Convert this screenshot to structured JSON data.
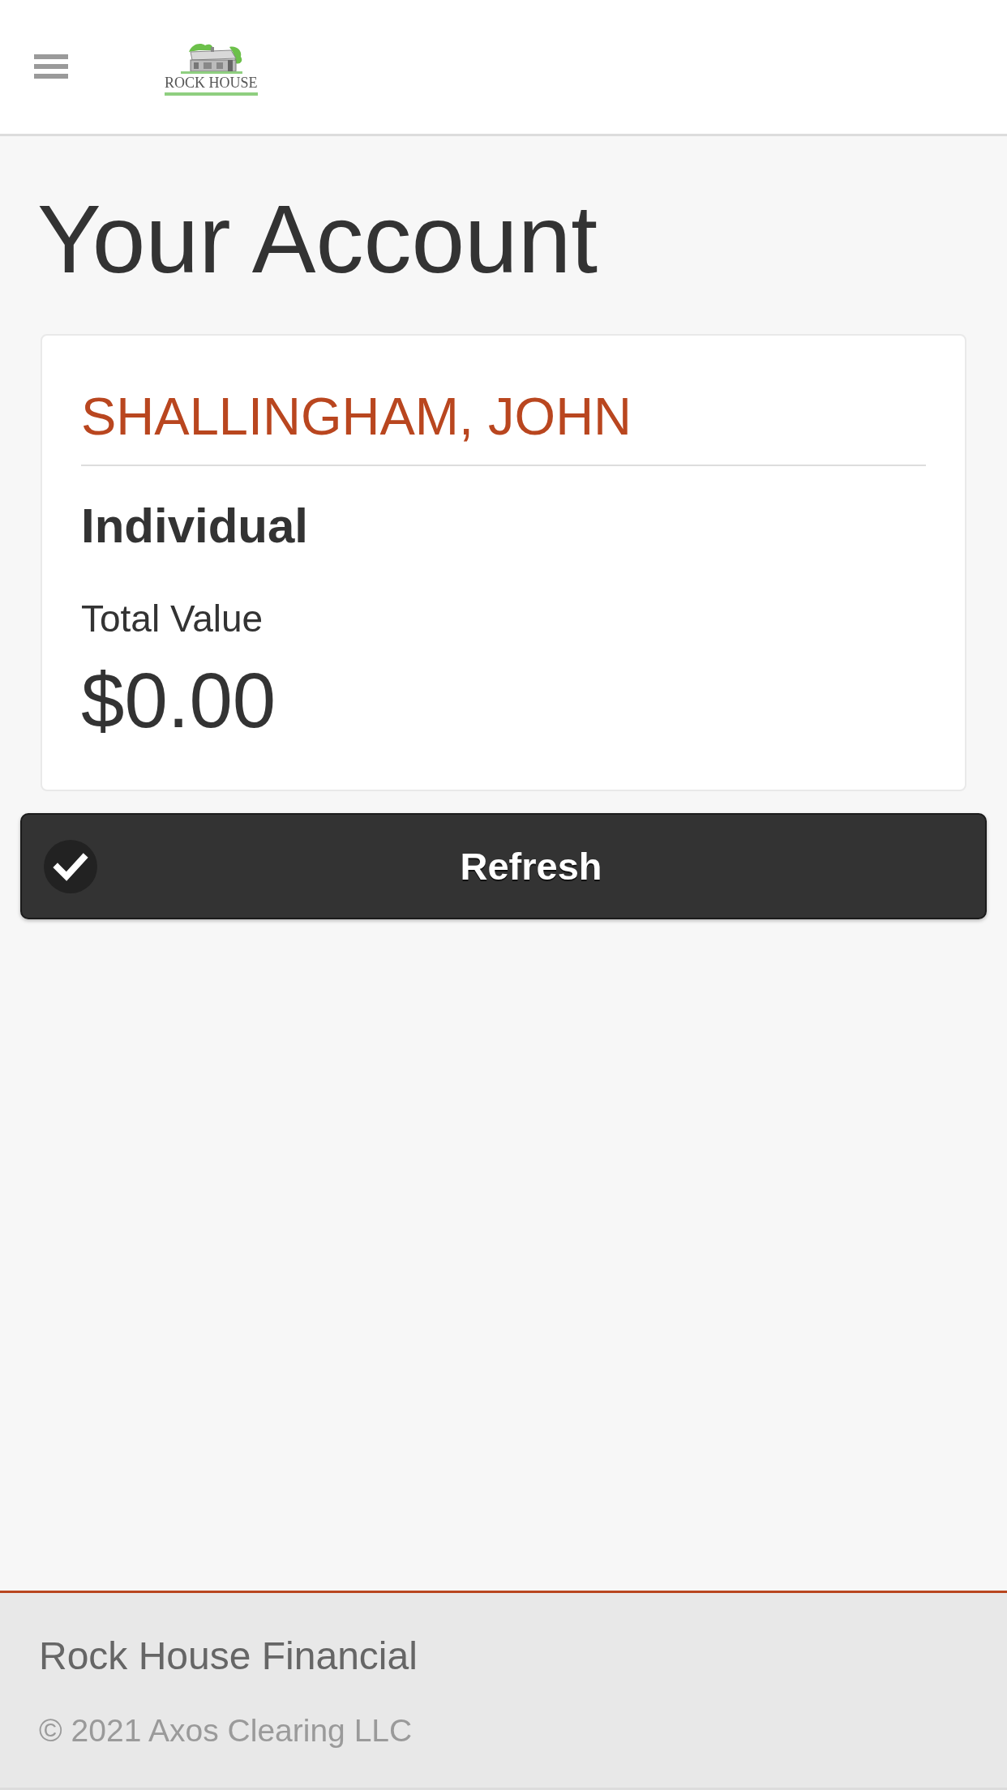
{
  "header": {
    "logo": {
      "text": "ROCK HOUSE"
    }
  },
  "page": {
    "title": "Your Account"
  },
  "account_card": {
    "name": "SHALLINGHAM, JOHN",
    "type": "Individual",
    "total_value_label": "Total Value",
    "total_value": "$0.00"
  },
  "refresh_button": {
    "label": "Refresh"
  },
  "footer": {
    "company": "Rock House Financial",
    "copyright": "© 2021 Axos Clearing LLC"
  }
}
